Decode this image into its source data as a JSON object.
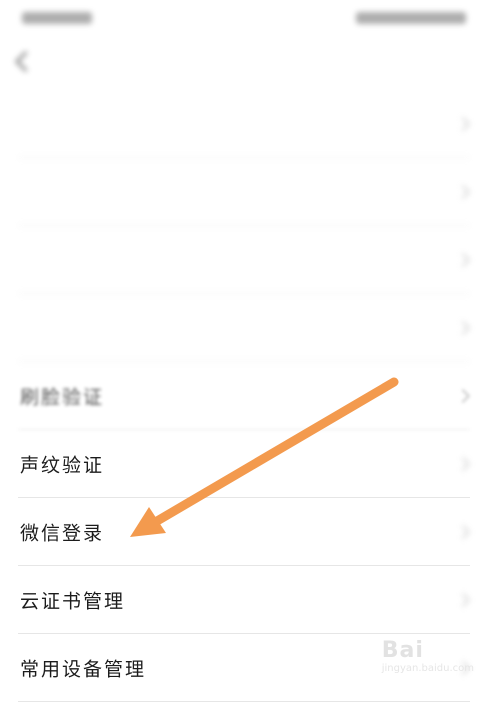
{
  "statusbar": {
    "left": "",
    "right": ""
  },
  "navbar": {
    "title": ""
  },
  "list": {
    "items": [
      {
        "label": "",
        "value": "",
        "tag": "",
        "state": "blurred"
      },
      {
        "label": "",
        "value": "",
        "tag": "",
        "state": "blurred"
      },
      {
        "label": "",
        "value": "",
        "tag": "",
        "state": "blurred"
      },
      {
        "label": "",
        "value": "",
        "tag": "",
        "state": "blurred"
      },
      {
        "label": "刷脸验证",
        "value": "",
        "state": "semi"
      },
      {
        "label": "声纹验证",
        "value": "",
        "state": "clear"
      },
      {
        "label": "微信登录",
        "value": "",
        "state": "clear"
      },
      {
        "label": "云证书管理",
        "value": "",
        "state": "clear"
      },
      {
        "label": "常用设备管理",
        "value": "",
        "state": "clear"
      }
    ]
  },
  "annotation": {
    "arrow_color": "#F39A4E"
  },
  "watermark": {
    "text": "Bai",
    "sub": "jingyan.baidu.com"
  }
}
